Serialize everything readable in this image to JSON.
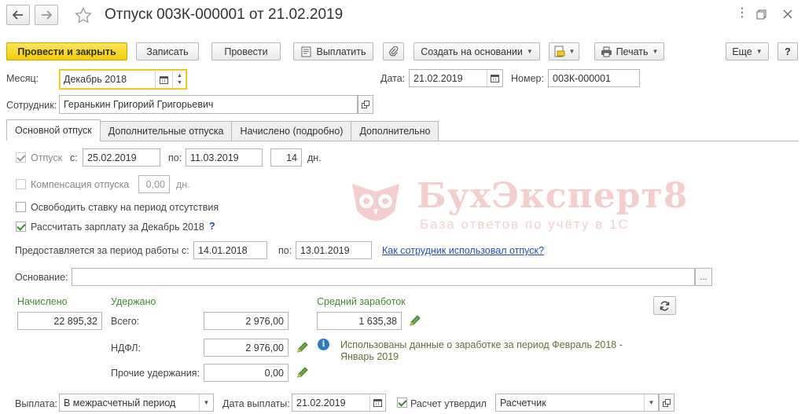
{
  "window": {
    "title": "Отпуск 003К-000001 от 21.02.2019"
  },
  "toolbar": {
    "post_close": "Провести и закрыть",
    "save": "Записать",
    "post": "Провести",
    "pay": "Выплатить",
    "create_based": "Создать на основании",
    "print": "Печать",
    "more": "Еще",
    "help": "?"
  },
  "header": {
    "month_label": "Месяц:",
    "month_value": "Декабрь 2018",
    "date_label": "Дата:",
    "date_value": "21.02.2019",
    "number_label": "Номер:",
    "number_value": "003К-000001",
    "employee_label": "Сотрудник:",
    "employee_value": "Геранькин Григорий Григорьевич"
  },
  "tabs": [
    {
      "label": "Основной отпуск"
    },
    {
      "label": "Дополнительные отпуска"
    },
    {
      "label": "Начислено (подробно)"
    },
    {
      "label": "Дополнительно"
    }
  ],
  "main": {
    "vacation_label": "Отпуск",
    "from_label": "с:",
    "from_value": "25.02.2019",
    "to_label": "по:",
    "to_value": "11.03.2019",
    "days_value": "14",
    "days_unit": "дн.",
    "compensation_label": "Компенсация отпуска",
    "compensation_value": "0,00",
    "compensation_unit": "дн.",
    "free_rate_label": "Освободить ставку на период отсутствия",
    "calc_salary_label": "Рассчитать зарплату за Декабрь 2018",
    "calc_salary_help": "?",
    "period_label": "Предоставляется за период работы с:",
    "period_from": "14.01.2018",
    "period_to_label": "по:",
    "period_to": "13.01.2019",
    "used_link": "Как сотрудник использовал отпуск?",
    "basis_label": "Основание:",
    "basis_value": "",
    "basis_btn": "...",
    "accrued_label": "Начислено",
    "accrued_value": "22 895,32",
    "withheld_label": "Удержано",
    "total_label": "Всего:",
    "total_value": "2 976,00",
    "ndfl_label": "НДФЛ:",
    "ndfl_value": "2 976,00",
    "other_label": "Прочие удержания:",
    "other_value": "0,00",
    "avg_label": "Средний заработок",
    "avg_value": "1 635,38",
    "info_text_1": "Использованы данные о заработке за период Февраль 2018 -",
    "info_text_2": "Январь 2019"
  },
  "footer": {
    "payout_label": "Выплата:",
    "payout_value": "В межрасчетный период",
    "pay_date_label": "Дата выплаты:",
    "pay_date_value": "21.02.2019",
    "approved_label": "Расчет утвердил",
    "approved_value": "Расчетчик"
  },
  "watermark": {
    "brand": "БухЭксперт8",
    "tagline": "База ответов по учёту в 1С"
  },
  "colors": {
    "primary_button": "#f2cc09",
    "green_text": "#3e8d2a",
    "link": "#1f4fb4",
    "watermark": "#d9534f"
  }
}
